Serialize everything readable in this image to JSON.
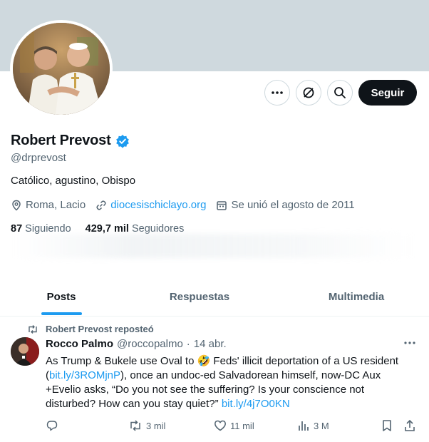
{
  "profile": {
    "name": "Robert Prevost",
    "handle": "@drprevost",
    "bio": "Católico, agustino, Obispo",
    "location": "Roma, Lacio",
    "website": "diocesischiclayo.org",
    "joined": "Se unió el agosto de 2011",
    "following_count": "87",
    "following_label": "Siguiendo",
    "followers_count": "429,7 mil",
    "followers_label": "Seguidores",
    "verified_icon": "verified-badge-icon"
  },
  "actions": {
    "more_icon": "more-icon",
    "grok_icon": "grok-icon",
    "search_icon": "search-icon",
    "follow_label": "Seguir"
  },
  "tabs": [
    {
      "label": "Posts",
      "active": true
    },
    {
      "label": "Respuestas",
      "active": false
    },
    {
      "label": "Multimedia",
      "active": false
    }
  ],
  "tweet": {
    "repost_label": "Robert Prevost reposteó",
    "author": "Rocco Palmo",
    "handle": "@roccopalmo",
    "separator": "·",
    "time": "14 abr.",
    "text_1": "As Trump & Bukele use Oval to 🤣 Feds' illicit deportation of a US resident (",
    "link_1": "bit.ly/3ROMjnP",
    "text_2": "), once an undoc-ed Salvadorean himself, now-DC Aux +Evelio asks, “Do you not see the suffering? Is your conscience not disturbed? How can you stay quiet?” ",
    "link_2": "bit.ly/4j7O0KN",
    "retweets": "3 mil",
    "likes": "11 mil",
    "views": "3 M"
  },
  "colors": {
    "accent": "#1d9bf0",
    "text_primary": "#0f1419",
    "text_secondary": "#536471",
    "banner": "#cfd9de"
  }
}
